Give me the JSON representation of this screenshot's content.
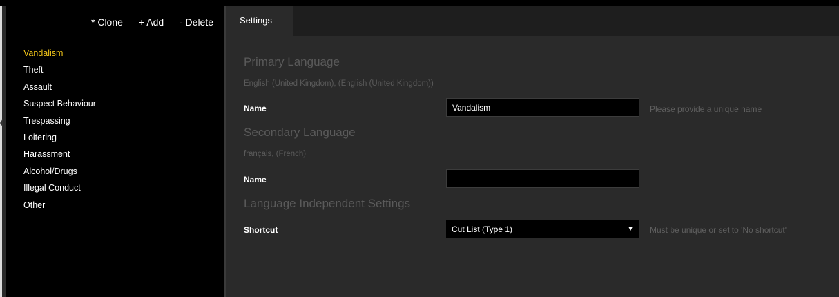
{
  "toolbar": {
    "clone_label": "* Clone",
    "add_label": "+ Add",
    "delete_label": "- Delete"
  },
  "sidebar": {
    "items": [
      {
        "label": "Vandalism",
        "selected": true
      },
      {
        "label": "Theft"
      },
      {
        "label": "Assault"
      },
      {
        "label": "Suspect Behaviour"
      },
      {
        "label": "Trespassing"
      },
      {
        "label": "Loitering"
      },
      {
        "label": "Harassment"
      },
      {
        "label": "Alcohol/Drugs"
      },
      {
        "label": "Illegal Conduct"
      },
      {
        "label": "Other"
      }
    ]
  },
  "tabs": [
    {
      "label": "Settings",
      "active": true
    }
  ],
  "primary": {
    "title": "Primary Language",
    "language": "English (United Kingdom), (English (United Kingdom))",
    "name_label": "Name",
    "name_value": "Vandalism",
    "name_hint": "Please provide a unique name"
  },
  "secondary": {
    "title": "Secondary Language",
    "language": "français, (French)",
    "name_label": "Name",
    "name_value": ""
  },
  "independent": {
    "title": "Language Independent Settings",
    "shortcut_label": "Shortcut",
    "shortcut_value": "Cut List (Type 1)",
    "shortcut_hint": "Must be unique or set to 'No shortcut'"
  },
  "colors": {
    "accent_selected": "#f0c419",
    "panel_background": "#2a2a2a",
    "sidebar_background": "#000000"
  }
}
